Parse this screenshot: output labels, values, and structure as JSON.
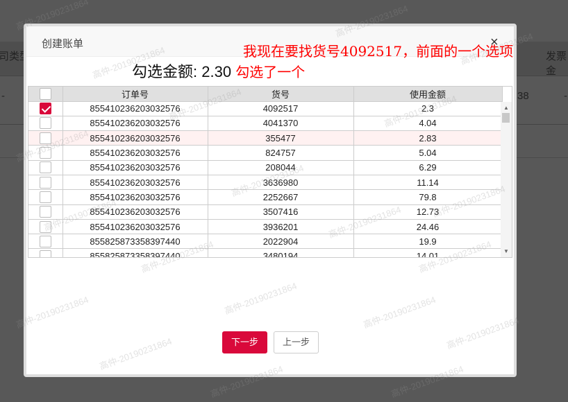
{
  "background": {
    "col_left": "司类型",
    "col_right": "发票金",
    "cell_value": "38",
    "dash": "-"
  },
  "modal": {
    "title": "创建账单",
    "close": "×",
    "annotation_top": "我现在要找货号4092517，前面的一个选项",
    "summary_label": "勾选金额:",
    "summary_value": "2.30",
    "annotation_sum": "勾选了一个",
    "columns": [
      "订单号",
      "货号",
      "使用金额"
    ],
    "rows": [
      {
        "checked": true,
        "order": "855410236203032576",
        "goods": "4092517",
        "amount": "2.3"
      },
      {
        "checked": false,
        "order": "855410236203032576",
        "goods": "4041370",
        "amount": "4.04"
      },
      {
        "checked": false,
        "order": "855410236203032576",
        "goods": "355477",
        "amount": "2.83",
        "highlight": true
      },
      {
        "checked": false,
        "order": "855410236203032576",
        "goods": "824757",
        "amount": "5.04"
      },
      {
        "checked": false,
        "order": "855410236203032576",
        "goods": "208044",
        "amount": "6.29"
      },
      {
        "checked": false,
        "order": "855410236203032576",
        "goods": "3636980",
        "amount": "11.14"
      },
      {
        "checked": false,
        "order": "855410236203032576",
        "goods": "2252667",
        "amount": "79.8"
      },
      {
        "checked": false,
        "order": "855410236203032576",
        "goods": "3507416",
        "amount": "12.73"
      },
      {
        "checked": false,
        "order": "855410236203032576",
        "goods": "3936201",
        "amount": "24.46"
      },
      {
        "checked": false,
        "order": "855825873358397440",
        "goods": "2022904",
        "amount": "19.9"
      },
      {
        "checked": false,
        "order": "855825873358397440",
        "goods": "3480194",
        "amount": "14.01"
      }
    ],
    "next_button": "下一步",
    "prev_button": "上一步"
  },
  "watermark": "高仲-20190231864",
  "colors": {
    "accent": "#d9093b",
    "annotation": "#ff0000"
  }
}
